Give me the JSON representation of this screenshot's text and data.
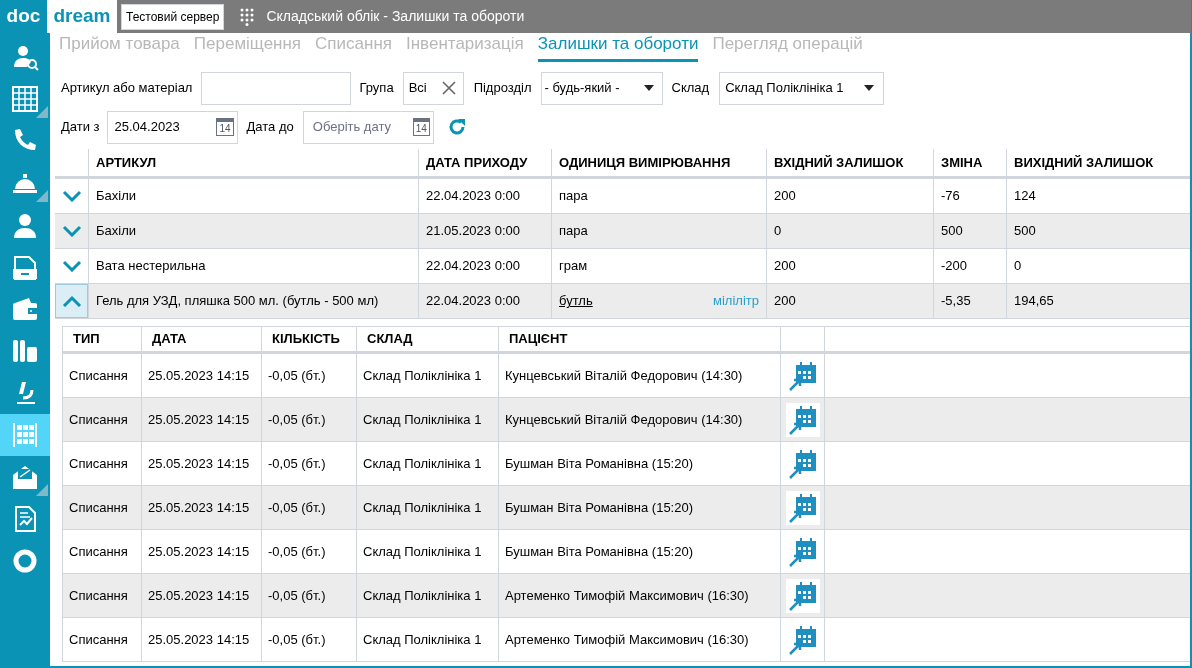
{
  "logo": {
    "part_1": "doc",
    "part_2": "dream"
  },
  "server_badge": "Тестовий сервер",
  "window": {
    "title": "Складський облік - Залишки та обороти"
  },
  "sidebar": {
    "items": [
      {
        "selected": false,
        "submenu": false
      },
      {
        "selected": false,
        "submenu": true
      },
      {
        "selected": false,
        "submenu": false
      },
      {
        "selected": false,
        "submenu": true
      },
      {
        "selected": false,
        "submenu": false
      },
      {
        "selected": false,
        "submenu": false
      },
      {
        "selected": false,
        "submenu": false
      },
      {
        "selected": false,
        "submenu": false
      },
      {
        "selected": false,
        "submenu": false
      },
      {
        "selected": true,
        "submenu": false
      },
      {
        "selected": false,
        "submenu": true
      },
      {
        "selected": false,
        "submenu": false
      },
      {
        "selected": false,
        "submenu": false
      }
    ]
  },
  "tabs": [
    {
      "label": "Прийом товара",
      "selected": false
    },
    {
      "label": "Переміщення",
      "selected": false
    },
    {
      "label": "Списання",
      "selected": false
    },
    {
      "label": "Інвентаризація",
      "selected": false
    },
    {
      "label": "Залишки та обороти",
      "selected": true
    },
    {
      "label": "Перегляд операцій",
      "selected": false
    }
  ],
  "filters": {
    "article_label": "Артикул або матеріал",
    "group_label": "Група",
    "group_value": "Всі",
    "unit_label": "Підрозділ",
    "unit_value": "- будь-який -",
    "warehouse_label": "Склад",
    "warehouse_value": "Склад Поліклініка 1",
    "date_from_label": "Дати з",
    "date_from_value": "25.04.2023",
    "date_from_icon": "14",
    "date_to_label": "Дата до",
    "date_to_placeholder": "Оберіть дату",
    "date_to_icon": "14"
  },
  "table": {
    "columns": [
      "АРТИКУЛ",
      "ДАТА ПРИХОДУ",
      "ОДИНИЦЯ ВИМІРЮВАННЯ",
      "ВХІДНИЙ ЗАЛИШОК",
      "ЗМІНА",
      "ВИХІДНИЙ ЗАЛИШОК"
    ],
    "rows": [
      {
        "expanded": false,
        "cells": [
          "Бахіли",
          "22.04.2023 0:00",
          "пара",
          "200",
          "-76",
          "124"
        ]
      },
      {
        "expanded": false,
        "cells": [
          "Бахіли",
          "21.05.2023 0:00",
          "пара",
          "0",
          "500",
          "500"
        ]
      },
      {
        "expanded": false,
        "cells": [
          "Вата нестерильна",
          "22.04.2023 0:00",
          "грам",
          "200",
          "-200",
          "0"
        ]
      },
      {
        "expanded": true,
        "cells": [
          "Гель для УЗД, пляшка 500 мл. (бутль - 500 мл)",
          "22.04.2023 0:00",
          "бутль",
          "200",
          "-5,35",
          "194,65"
        ],
        "secondary_unit": "мілілітр"
      }
    ]
  },
  "details": {
    "columns": [
      "ТИП",
      "ДАТА",
      "КІЛЬКІСТЬ",
      "СКЛАД",
      "ПАЦІЄНТ"
    ],
    "rows": [
      [
        "Списання",
        "25.05.2023 14:15",
        "-0,05 (бт.)",
        "Склад Поліклініка 1",
        "Кунцевський Віталій Федорович (14:30)"
      ],
      [
        "Списання",
        "25.05.2023 14:15",
        "-0,05 (бт.)",
        "Склад Поліклініка 1",
        "Кунцевський Віталій Федорович (14:30)"
      ],
      [
        "Списання",
        "25.05.2023 14:15",
        "-0,05 (бт.)",
        "Склад Поліклініка 1",
        "Бушман Віта Романівна (15:20)"
      ],
      [
        "Списання",
        "25.05.2023 14:15",
        "-0,05 (бт.)",
        "Склад Поліклініка 1",
        "Бушман Віта Романівна (15:20)"
      ],
      [
        "Списання",
        "25.05.2023 14:15",
        "-0,05 (бт.)",
        "Склад Поліклініка 1",
        "Бушман Віта Романівна (15:20)"
      ],
      [
        "Списання",
        "25.05.2023 14:15",
        "-0,05 (бт.)",
        "Склад Поліклініка 1",
        "Артеменко Тимофій Максимович (16:30)"
      ],
      [
        "Списання",
        "25.05.2023 14:15",
        "-0,05 (бт.)",
        "Склад Поліклініка 1",
        "Артеменко Тимофій Максимович (16:30)"
      ]
    ]
  }
}
